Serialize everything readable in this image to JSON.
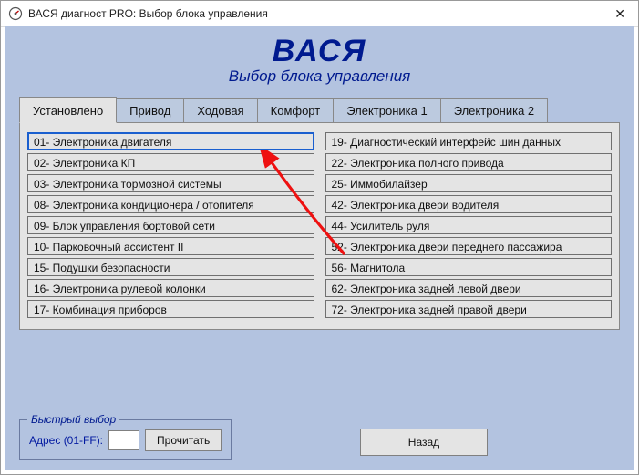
{
  "window": {
    "title": "ВАСЯ диагност PRO:  Выбор блока управления"
  },
  "brand": "ВАСЯ",
  "subtitle": "Выбор блока управления",
  "tabs": [
    {
      "label": "Установлено",
      "active": true
    },
    {
      "label": "Привод",
      "active": false
    },
    {
      "label": "Ходовая",
      "active": false
    },
    {
      "label": "Комфорт",
      "active": false
    },
    {
      "label": "Электроника 1",
      "active": false
    },
    {
      "label": "Электроника 2",
      "active": false
    }
  ],
  "modules_left": [
    "01- Электроника двигателя",
    "02- Электроника КП",
    "03- Электроника тормозной системы",
    "08- Электроника кондиционера / отопителя",
    "09- Блок управления бортовой сети",
    "10- Парковочный ассистент II",
    "15- Подушки безопасности",
    "16- Электроника рулевой колонки",
    "17- Комбинация приборов"
  ],
  "modules_right": [
    "19- Диагностический интерфейс шин данных",
    "22- Электроника полного привода",
    "25- Иммобилайзер",
    "42- Электроника двери водителя",
    "44- Усилитель руля",
    "52- Электроника двери переднего пассажира",
    "56- Магнитола",
    "62- Электроника задней левой двери",
    "72- Электроника задней правой двери"
  ],
  "selected_module_index": 0,
  "quick": {
    "group_label": "Быстрый выбор",
    "addr_label": "Адрес (01-FF):",
    "addr_value": "",
    "read_label": "Прочитать"
  },
  "back_label": "Назад",
  "colors": {
    "client_bg": "#b3c3e0",
    "accent": "#001a8f",
    "tabbody": "#e4e4e4",
    "selected_border": "#1a5fcf"
  }
}
